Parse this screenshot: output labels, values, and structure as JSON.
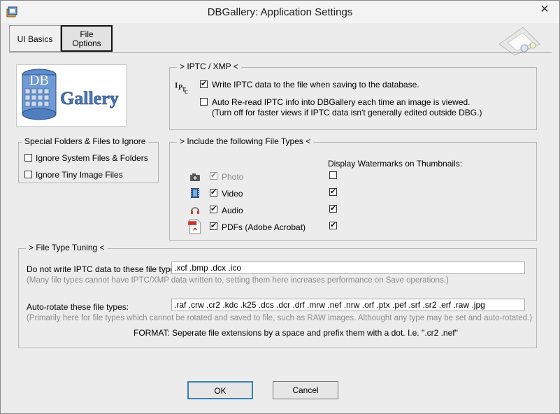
{
  "window": {
    "title": "DBGallery: Application Settings",
    "close_glyph": "✕"
  },
  "tabs": [
    {
      "label": "UI Basics"
    },
    {
      "label_line1": "File",
      "label_line2": "Options"
    }
  ],
  "logo": {
    "small": "DB",
    "big": "Gallery"
  },
  "iptc": {
    "title": "> IPTC / XMP <",
    "write_label": "Write IPTC data to the file when saving to the database.",
    "write_checked": true,
    "reread_label": "Auto Re-read IPTC info into DBGallery each time an image is viewed.",
    "reread_note": "(Turn off for faster views if IPTC data isn't generally edited outside DBG.)",
    "reread_checked": false
  },
  "special": {
    "title": "Special Folders & Files to Ignore",
    "items": [
      {
        "label": "Ignore System Files & Folders",
        "checked": false
      },
      {
        "label": "Ignore Tiny Image Files",
        "checked": false
      }
    ]
  },
  "filetypes": {
    "title": "> Include the following File Types <",
    "watermark_header": "Display Watermarks on Thumbnails:",
    "rows": [
      {
        "label": "Photo",
        "icon": "camera-icon",
        "include": true,
        "enabled": false,
        "watermark": false
      },
      {
        "label": "Video",
        "icon": "film-icon",
        "include": true,
        "enabled": true,
        "watermark": true
      },
      {
        "label": "Audio",
        "icon": "headphones-icon",
        "include": true,
        "enabled": true,
        "watermark": true
      },
      {
        "label": "PDFs  (Adobe Acrobat)",
        "icon": "pdf-icon",
        "include": true,
        "enabled": true,
        "watermark": true
      }
    ]
  },
  "tuning": {
    "title": "> File Type Tuning <",
    "no_iptc_label": "Do not write IPTC data to these file types:",
    "no_iptc_value": ".xcf .bmp .dcx .ico",
    "no_iptc_hint": "(Many file types cannot have IPTC/XMP data written to, setting them here increases performance on Save operations.)",
    "autorotate_label": "Auto-rotate these file types:",
    "autorotate_value": ".raf .crw .cr2 .kdc .k25 .dcs .dcr .drf .mrw .nef .nrw .orf .ptx .pef .srf .sr2 .erf .raw .jpg",
    "autorotate_hint": "(Primarily here for file types which cannot be rotated and saved to file, such as RAW images.  Althought any type may be set and auto-rotated.)",
    "format_note": "FORMAT: Seperate file extensions by a space and prefix them with a dot. I.e.  \".cr2 .nef\""
  },
  "buttons": {
    "ok": "OK",
    "cancel": "Cancel"
  }
}
